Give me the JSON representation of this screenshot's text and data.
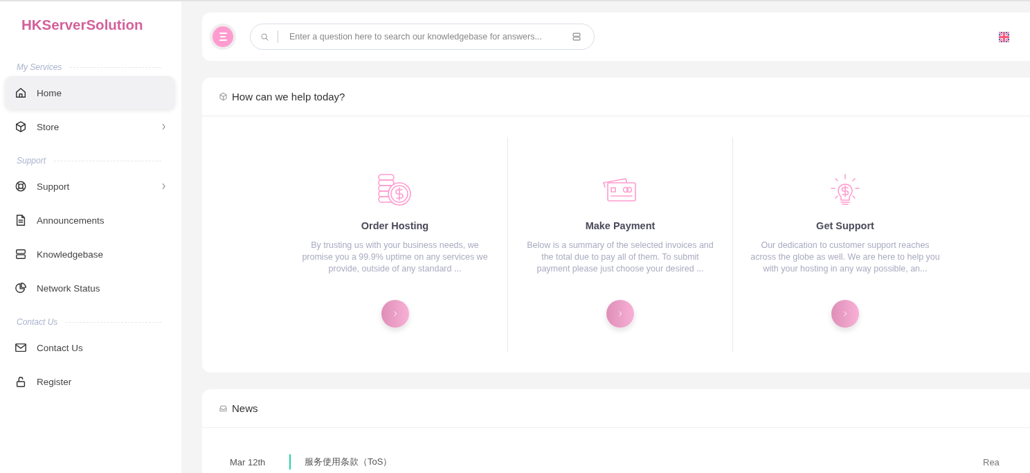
{
  "brand": "HKServerSolution",
  "sidebar": {
    "sections": [
      {
        "title": "My Services",
        "items": [
          {
            "label": "Home",
            "kind": "home",
            "selected": true,
            "has_submenu": false
          },
          {
            "label": "Store",
            "kind": "box",
            "selected": false,
            "has_submenu": true
          }
        ]
      },
      {
        "title": "Support",
        "items": [
          {
            "label": "Support",
            "kind": "lifebuoy",
            "selected": false,
            "has_submenu": true
          },
          {
            "label": "Announcements",
            "kind": "document",
            "selected": false,
            "has_submenu": false
          },
          {
            "label": "Knowledgebase",
            "kind": "server",
            "selected": false,
            "has_submenu": false
          },
          {
            "label": "Network Status",
            "kind": "pie",
            "selected": false,
            "has_submenu": false
          }
        ]
      },
      {
        "title": "Contact Us",
        "items": [
          {
            "label": "Contact Us",
            "kind": "envelope",
            "selected": false,
            "has_submenu": false
          },
          {
            "label": "Register",
            "kind": "lock",
            "selected": false,
            "has_submenu": false
          }
        ]
      }
    ]
  },
  "topbar": {
    "search": {
      "placeholder": "Enter a question here to search our knowledgebase for answers..."
    }
  },
  "help": {
    "title": "How can we help today?",
    "cards": [
      {
        "kind": "coins",
        "title": "Order Hosting",
        "text": "By trusting us with your business needs, we promise you a 99.9% uptime on any services we provide, outside of any standard ..."
      },
      {
        "kind": "cards",
        "title": "Make Payment",
        "text": "Below is a summary of the selected invoices and the total due to pay all of them. To submit payment please just choose your desired ..."
      },
      {
        "kind": "bulb",
        "title": "Get Support",
        "text": "Our dedication to customer support reaches across the globe as well. We are here to help you with your hosting in any way possible, an..."
      }
    ]
  },
  "news": {
    "title": "News",
    "items": [
      {
        "date": "Mar 12th",
        "title": "服务使用条款（ToS）",
        "link": "Rea"
      }
    ]
  }
}
